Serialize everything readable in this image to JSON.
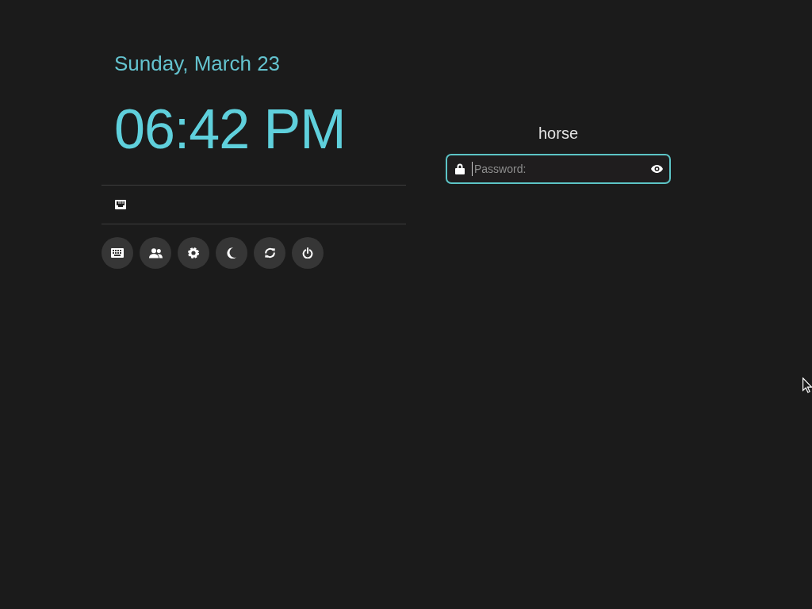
{
  "clock": {
    "date": "Sunday, March 23",
    "time": "06:42 PM"
  },
  "indicators": [
    {
      "kind": "wired"
    }
  ],
  "actions": [
    {
      "kind": "keyboard"
    },
    {
      "kind": "users"
    },
    {
      "kind": "settings"
    },
    {
      "kind": "suspend"
    },
    {
      "kind": "restart"
    },
    {
      "kind": "power"
    }
  ],
  "login": {
    "username": "horse",
    "password": {
      "placeholder": "Password:",
      "focused": true
    }
  }
}
